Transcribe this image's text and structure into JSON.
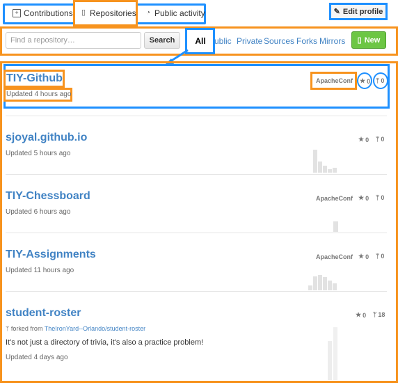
{
  "tabs": [
    {
      "label": "Contributions",
      "icon": "contributions-icon"
    },
    {
      "label": "Repositories",
      "icon": "repo-icon"
    },
    {
      "label": "Public activity",
      "icon": "rss-icon"
    }
  ],
  "edit_profile": {
    "label": "Edit profile",
    "icon": "pencil-icon"
  },
  "search": {
    "placeholder": "Find a repository…",
    "button": "Search"
  },
  "filters": {
    "all": "All",
    "items": [
      "ublic",
      "Private",
      "Sources",
      "Forks",
      "Mirrors"
    ]
  },
  "new_button": {
    "label": "New",
    "icon": "repo-icon"
  },
  "repos": [
    {
      "name": "TIY-Github",
      "updated": "Updated 4 hours ago",
      "language": "ApacheConf",
      "stars": "0",
      "forks": "0"
    },
    {
      "name": "sjoyal.github.io",
      "updated": "Updated 5 hours ago",
      "language": "",
      "stars": "0",
      "forks": "0"
    },
    {
      "name": "TIY-Chessboard",
      "updated": "Updated 6 hours ago",
      "language": "ApacheConf",
      "stars": "0",
      "forks": "0"
    },
    {
      "name": "TIY-Assignments",
      "updated": "Updated 11 hours ago",
      "language": "ApacheConf",
      "stars": "0",
      "forks": "0"
    },
    {
      "name": "student-roster",
      "forked_prefix": "forked from",
      "forked_from": "TheIronYard--Orlando/student-roster",
      "description": "It's not just a directory of trivia, it's also a practice problem!",
      "updated": "Updated 4 days ago",
      "language": "",
      "stars": "0",
      "forks": "18"
    }
  ],
  "colors": {
    "annotation_blue": "#1e90ff",
    "annotation_orange": "#f7931e",
    "link": "#4183c4",
    "new_button": "#6cc644"
  }
}
